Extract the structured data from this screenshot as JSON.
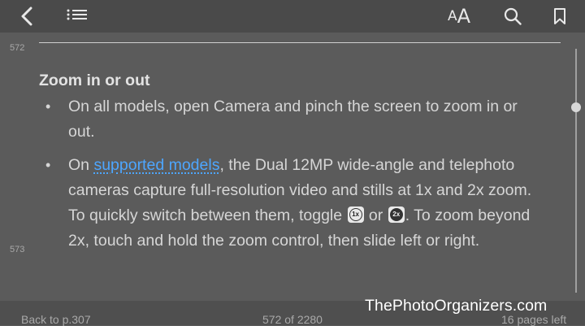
{
  "toolbar": {
    "font_small": "A",
    "font_big": "A"
  },
  "margin_pages": {
    "top": "572",
    "bottom": "573"
  },
  "section": {
    "heading": "Zoom in or out",
    "bullet_1": "On all models, open Camera and pinch the screen to zoom in or out.",
    "bullet_2_before": "On ",
    "bullet_2_link": "supported models",
    "bullet_2_after": ", the Dual 12MP wide-angle and telephoto cameras capture full-resolution video and stills at 1x and 2x zoom. To quickly switch between them, toggle ",
    "zoom_1x": "1x",
    "bullet_2_or": " or ",
    "zoom_2x": "2x",
    "bullet_2_end": ". To zoom beyond 2x, touch and hold the zoom control, then slide left or right."
  },
  "bottom": {
    "back": "Back to p.307",
    "counter": "572 of 2280",
    "pages_left": "16 pages left"
  },
  "watermark": "ThePhotoOrganizers.com",
  "colors": {
    "background": "#5b5b5b",
    "toolbar": "#4a4a4a",
    "link": "#4da6ff",
    "text": "#d6d6d6"
  },
  "icons": {
    "back": "chevron-left-icon",
    "toc": "list-icon",
    "font": "font-size-icon",
    "search": "search-icon",
    "bookmark": "bookmark-icon"
  }
}
